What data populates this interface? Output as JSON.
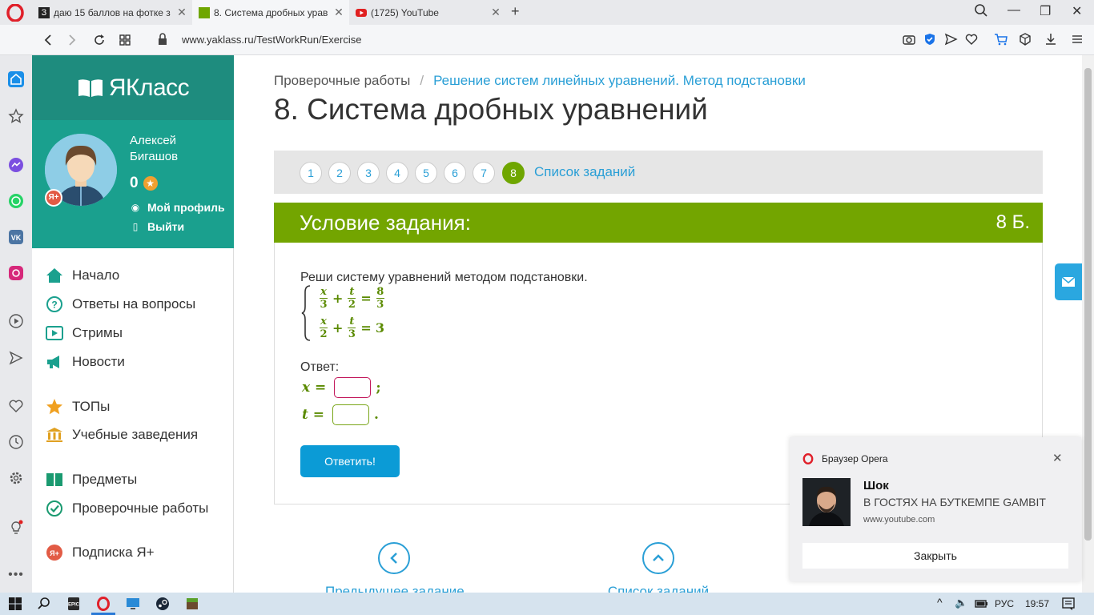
{
  "browser": {
    "tabs": [
      {
        "label": "даю 15 баллов на фотке з",
        "active": false
      },
      {
        "label": "8. Система дробных урав",
        "active": true
      },
      {
        "label": "(1725) YouTube",
        "active": false
      }
    ],
    "url": "www.yaklass.ru/TestWorkRun/Exercise"
  },
  "site": {
    "logo": "ЯКласс",
    "user": {
      "name": "Алексей Бигашов",
      "points": "0",
      "badge": "Я+",
      "profile_link": "Мой профиль",
      "logout_link": "Выйти"
    },
    "menu": [
      {
        "label": "Начало",
        "icon": "home-icon"
      },
      {
        "label": "Ответы на вопросы",
        "icon": "question-icon"
      },
      {
        "label": "Стримы",
        "icon": "play-icon"
      },
      {
        "label": "Новости",
        "icon": "megaphone-icon"
      },
      {
        "label": "ТОПы",
        "icon": "star-icon"
      },
      {
        "label": "Учебные заведения",
        "icon": "building-icon"
      },
      {
        "label": "Предметы",
        "icon": "book-icon"
      },
      {
        "label": "Проверочные работы",
        "icon": "check-icon"
      },
      {
        "label": "Подписка Я+",
        "icon": "ya-plus-icon"
      }
    ]
  },
  "main": {
    "breadcrumb": {
      "root": "Проверочные работы",
      "separator": "/",
      "current": "Решение систем линейных уравнений. Метод подстановки"
    },
    "title": "8. Система дробных уравнений",
    "pager": {
      "numbers": [
        "1",
        "2",
        "3",
        "4",
        "5",
        "6",
        "7",
        "8"
      ],
      "current": "8",
      "list_label": "Список заданий"
    },
    "task": {
      "header": "Условие задания:",
      "score": "8 Б.",
      "condition": "Реши систему уравнений методом подстановки.",
      "eq1": {
        "a_num": "x",
        "a_den": "3",
        "plus": "+",
        "b_num": "t",
        "b_den": "2",
        "equals": "=",
        "r_num": "8",
        "r_den": "3"
      },
      "eq2": {
        "a_num": "x",
        "a_den": "2",
        "plus": "+",
        "b_num": "t",
        "b_den": "3",
        "equals": "=",
        "result": "3"
      },
      "answer_label": "Ответ:",
      "x_label": "x =",
      "x_value": "",
      "x_punct": ";",
      "t_label": "t =",
      "t_value": "",
      "t_punct": ".",
      "submit": "Ответить!"
    },
    "bottom_nav": {
      "prev": "Предыдущее задание",
      "list": "Список заданий"
    }
  },
  "notification": {
    "app": "Браузер Opera",
    "title": "Шок",
    "text": "В ГОСТЯХ НА БУТКЕМПЕ GAMBIT",
    "url": "www.youtube.com",
    "button": "Закрыть"
  },
  "taskbar": {
    "lang": "РУС",
    "time": "19:57"
  },
  "colors": {
    "teal_dark": "#1e8c7e",
    "teal": "#1aa08e",
    "green": "#73a500",
    "blue": "#2a9fd6",
    "button_blue": "#0b9bd6"
  }
}
